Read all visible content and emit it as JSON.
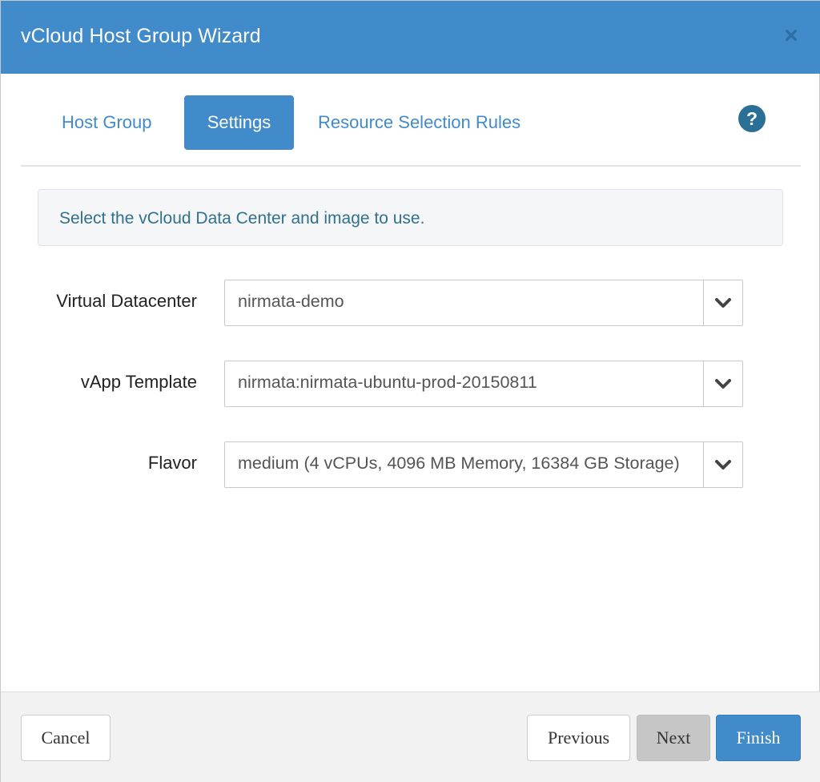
{
  "dialog": {
    "title": "vCloud Host Group Wizard",
    "close_glyph": "×",
    "close_icon": "close-icon"
  },
  "tabs": [
    {
      "label": "Host Group",
      "active": false
    },
    {
      "label": "Settings",
      "active": true
    },
    {
      "label": "Resource Selection Rules",
      "active": false
    }
  ],
  "help": {
    "glyph": "?",
    "icon": "help-icon"
  },
  "info": {
    "text": "Select the vCloud Data Center and image to use."
  },
  "form": {
    "virtual_datacenter": {
      "label": "Virtual Datacenter",
      "value": "nirmata-demo"
    },
    "vapp_template": {
      "label": "vApp Template",
      "value": "nirmata:nirmata-ubuntu-prod-20150811"
    },
    "flavor": {
      "label": "Flavor",
      "value": "medium (4 vCPUs, 4096 MB Memory, 16384 GB Storage)"
    },
    "dropdown_icon": "chevron-down-icon"
  },
  "footer": {
    "cancel_label": "Cancel",
    "previous_label": "Previous",
    "next_label": "Next",
    "finish_label": "Finish"
  },
  "colors": {
    "primary": "#428bca",
    "info_text": "#31708f",
    "help_icon": "#2a6f96",
    "disabled_button": "#c6c6c6"
  }
}
